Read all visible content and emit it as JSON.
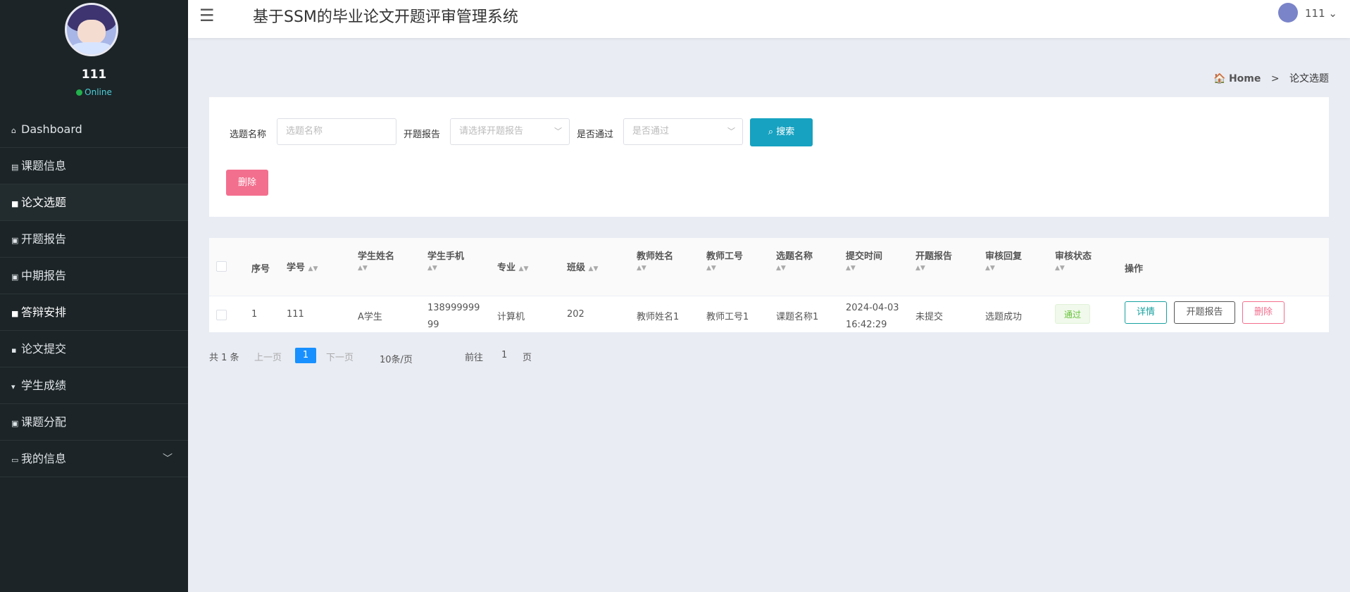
{
  "sidebar": {
    "user_name": "111",
    "status": "Online",
    "items": [
      {
        "icon": "home-icon",
        "label": "Dashboard"
      },
      {
        "icon": "notes-icon",
        "label": "课题信息"
      },
      {
        "icon": "briefcase-icon",
        "label": "论文选题"
      },
      {
        "icon": "clipboard-icon",
        "label": "开题报告"
      },
      {
        "icon": "clipboard-icon",
        "label": "中期报告"
      },
      {
        "icon": "chat-icon",
        "label": "答辩安排"
      },
      {
        "icon": "chat-icon",
        "label": "论文提交"
      },
      {
        "icon": "trophy-icon",
        "label": "学生成绩"
      },
      {
        "icon": "clipboard-icon",
        "label": "课题分配"
      },
      {
        "icon": "id-card-icon",
        "label": "我的信息"
      }
    ]
  },
  "header": {
    "title": "基于SSM的毕业论文开题评审管理系统",
    "user": "111"
  },
  "breadcrumb": {
    "home": "Home",
    "separator": ">",
    "current": "论文选题"
  },
  "search": {
    "topic_label": "选题名称",
    "topic_placeholder": "选题名称",
    "report_label": "开题报告",
    "report_placeholder": "请选择开题报告",
    "pass_label": "是否通过",
    "pass_placeholder": "是否通过",
    "search_button": "搜索",
    "delete_button": "删除"
  },
  "table": {
    "headers": [
      "序号",
      "学号",
      "学生姓名",
      "学生手机",
      "专业",
      "班级",
      "教师姓名",
      "教师工号",
      "选题名称",
      "提交时间",
      "开题报告",
      "审核回复",
      "审核状态",
      "操作"
    ],
    "rows": [
      {
        "index": "1",
        "student_no": "111",
        "student_name": "A学生",
        "phone_line1": "138999999",
        "phone_line2": "99",
        "major": "计算机",
        "class": "202",
        "teacher_name": "教师姓名1",
        "teacher_no": "教师工号1",
        "topic": "课题名称1",
        "time_line1": "2024-04-03",
        "time_line2": "16:42:29",
        "report": "未提交",
        "reply": "选题成功",
        "status": "通过",
        "actions": {
          "detail": "详情",
          "report": "开题报告",
          "delete": "删除"
        }
      }
    ]
  },
  "pagination": {
    "total": "共 1 条",
    "prev": "上一页",
    "current": "1",
    "next": "下一页",
    "page_size": "10条/页",
    "goto_label": "前往",
    "goto_value": "1",
    "page_unit": "页"
  }
}
